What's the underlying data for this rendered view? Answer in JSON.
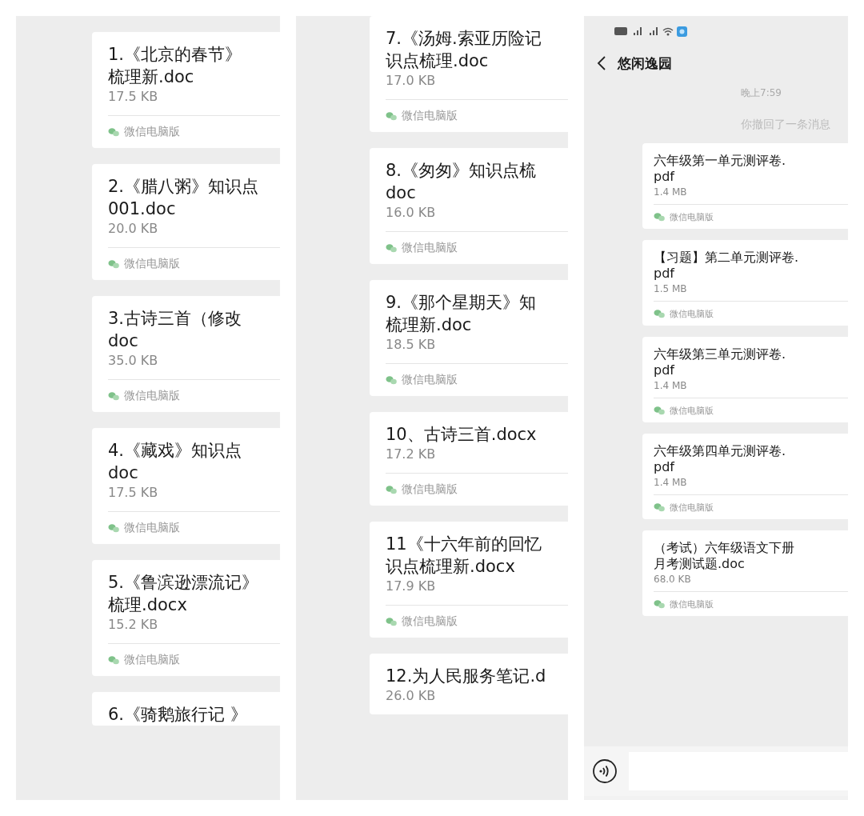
{
  "panels": [
    {
      "kind": "file_list",
      "messages": [
        {
          "name_lines": [
            "1.《北京的春节》",
            "梳理新.doc"
          ],
          "size": "17.5 KB",
          "source": "微信电脑版"
        },
        {
          "name_lines": [
            "2.《腊八粥》知识点",
            "001.doc"
          ],
          "size": "20.0 KB",
          "source": "微信电脑版"
        },
        {
          "name_lines": [
            "3.古诗三首（修改",
            "doc"
          ],
          "size": "35.0 KB",
          "source": "微信电脑版"
        },
        {
          "name_lines": [
            "4.《藏戏》知识点",
            "doc"
          ],
          "size": "17.5 KB",
          "source": "微信电脑版"
        },
        {
          "name_lines": [
            "5.《鲁滨逊漂流记》",
            "梳理.docx"
          ],
          "size": "15.2 KB",
          "source": "微信电脑版"
        },
        {
          "name_lines": [
            "6.《骑鹅旅行记 》"
          ]
        }
      ]
    },
    {
      "kind": "file_list",
      "messages": [
        {
          "name_lines": [
            "7.《汤姆.索亚历险记",
            "识点梳理.doc"
          ],
          "size": "17.0 KB",
          "source": "微信电脑版"
        },
        {
          "name_lines": [
            "8.《匆匆》知识点梳",
            "doc"
          ],
          "size": "16.0 KB",
          "source": "微信电脑版"
        },
        {
          "name_lines": [
            "9.《那个星期天》知",
            "梳理新.doc"
          ],
          "size": "18.5 KB",
          "source": "微信电脑版"
        },
        {
          "name_lines": [
            "10、古诗三首.docx"
          ],
          "size": "17.2 KB",
          "source": "微信电脑版"
        },
        {
          "name_lines": [
            "11《十六年前的回忆",
            "识点梳理新.docx"
          ],
          "size": "17.9 KB",
          "source": "微信电脑版"
        },
        {
          "name_lines": [
            "12.为人民服务笔记.d"
          ],
          "size": "26.0 KB"
        }
      ]
    },
    {
      "kind": "chat",
      "title": "悠闲逸园",
      "timestamp": "晚上7:59",
      "notice": "你撤回了一条消息",
      "messages": [
        {
          "name_lines": [
            "六年级第一单元测评卷.",
            "pdf"
          ],
          "size": "1.4 MB",
          "source": "微信电脑版"
        },
        {
          "name_lines": [
            "【习题】第二单元测评卷.",
            "pdf"
          ],
          "size": "1.5 MB",
          "source": "微信电脑版"
        },
        {
          "name_lines": [
            "六年级第三单元测评卷.",
            "pdf"
          ],
          "size": "1.4 MB",
          "source": "微信电脑版"
        },
        {
          "name_lines": [
            "六年级第四单元测评卷.",
            "pdf"
          ],
          "size": "1.4 MB",
          "source": "微信电脑版"
        },
        {
          "name_lines": [
            "（考试）六年级语文下册",
            "月考测试题.doc"
          ],
          "size": "68.0 KB",
          "source": "微信电脑版"
        }
      ]
    }
  ]
}
